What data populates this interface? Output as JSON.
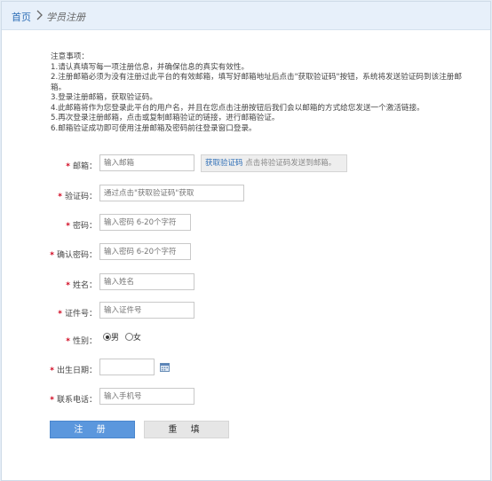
{
  "breadcrumb": {
    "home": "首页",
    "current": "学员注册"
  },
  "notes": {
    "title": "注意事项：",
    "items": [
      "1.请认真填写每一项注册信息，并确保信息的真实有效性。",
      "2.注册邮箱必须为没有注册过此平台的有效邮箱，填写好邮箱地址后点击\"获取验证码\"按钮，系统将发送验证码到该注册邮箱。",
      "3.登录注册邮箱，获取验证码。",
      "4.此邮箱将作为您登录此平台的用户名，并且在您点击注册按钮后我们会以邮箱的方式给您发送一个激活链接。",
      "5.再次登录注册邮箱，点击或复制邮箱验证的链接，进行邮箱验证。",
      "6.邮箱验证成功即可使用注册邮箱及密码前往登录窗口登录。"
    ]
  },
  "form": {
    "required_mark": "*",
    "email": {
      "label": "邮箱：",
      "placeholder": "输入邮箱"
    },
    "get_code": {
      "link": "获取验证码",
      "hint": "点击将验证码发送到邮箱。"
    },
    "code": {
      "label": "验证码：",
      "placeholder": "通过点击\"获取验证码\"获取"
    },
    "password": {
      "label": "密码：",
      "placeholder": "输入密码 6-20个字符"
    },
    "confirm": {
      "label": "确认密码：",
      "placeholder": "输入密码 6-20个字符"
    },
    "name": {
      "label": "姓名：",
      "placeholder": "输入姓名"
    },
    "id_number": {
      "label": "证件号：",
      "placeholder": "输入证件号"
    },
    "gender": {
      "label": "性别：",
      "male": "男",
      "female": "女",
      "selected": "男"
    },
    "birth": {
      "label": "出生日期：",
      "value": ""
    },
    "phone": {
      "label": "联系电话：",
      "placeholder": "输入手机号"
    }
  },
  "buttons": {
    "submit": "注 册",
    "reset": "重 填"
  },
  "icons": {
    "separator": "chevron-right-icon",
    "calendar": "calendar-icon"
  },
  "colors": {
    "accent": "#2f6fb7",
    "button": "#5b97dd",
    "required": "#d0021b",
    "topbar": "#e7f0fa"
  }
}
